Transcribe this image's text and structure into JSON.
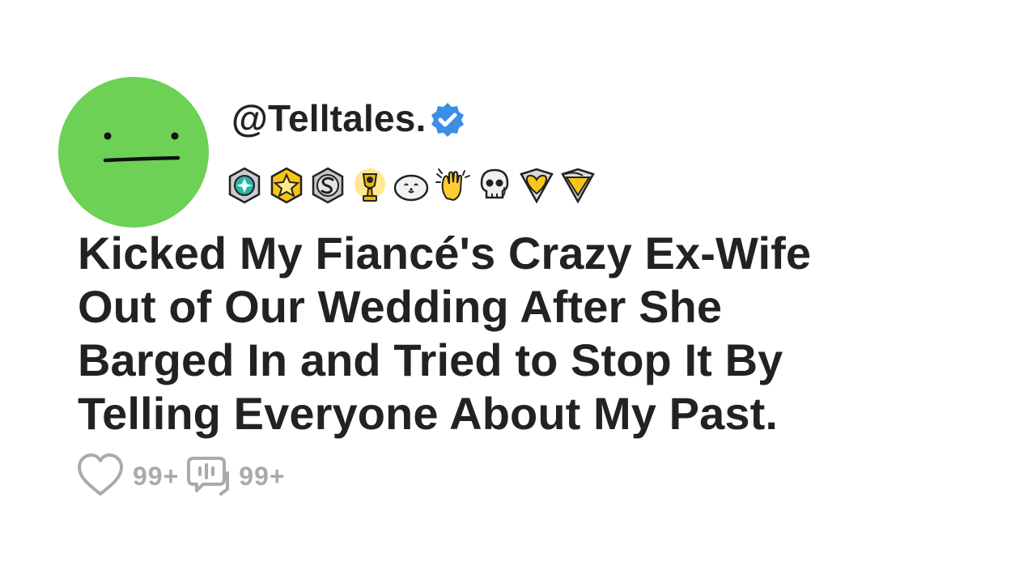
{
  "post": {
    "username": "@Telltales.",
    "verified_icon": "verified-badge-icon",
    "title_lines": [
      "Kicked My Fiancé's Crazy Ex-Wife",
      "Out of Our Wedding After She",
      "Barged In and Tried to Stop It By",
      "Telling Everyone About My Past."
    ]
  },
  "awards": [
    "teal-gem-award-icon",
    "gold-star-award-icon",
    "silver-s-award-icon",
    "gold-trophy-award-icon",
    "seal-award-icon",
    "clapping-hands-award-icon",
    "crying-skull-award-icon",
    "gold-heart-shield-award-icon",
    "gold-wing-shield-award-icon"
  ],
  "stats": {
    "likes": "99+",
    "comments": "99+",
    "like_icon": "heart-icon",
    "comment_icon": "comment-icon"
  },
  "colors": {
    "avatar": "#6cd155",
    "verified": "#3b8ee6",
    "text": "#222222",
    "stats": "#aaaaaa"
  }
}
